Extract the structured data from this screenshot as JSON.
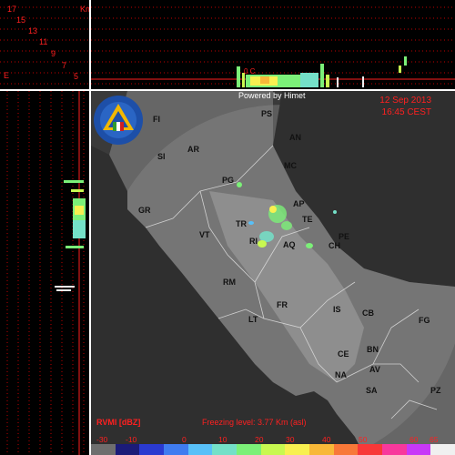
{
  "profile": {
    "km_label": "Km",
    "height_ticks": [
      "17",
      "15",
      "13",
      "11",
      "9",
      "7",
      "5"
    ],
    "corner_label": "E",
    "freezing_marker": "0 C"
  },
  "header": {
    "powered_by": "Powered by Himet",
    "date": "12 Sep 2013",
    "time": "16:45 CEST"
  },
  "map": {
    "cities": [
      {
        "code": "PS"
      },
      {
        "code": "FI"
      },
      {
        "code": "AN"
      },
      {
        "code": "AR"
      },
      {
        "code": "SI"
      },
      {
        "code": "MC"
      },
      {
        "code": "PG"
      },
      {
        "code": "GR"
      },
      {
        "code": "AP"
      },
      {
        "code": "TE"
      },
      {
        "code": "TR"
      },
      {
        "code": "PE"
      },
      {
        "code": "VT"
      },
      {
        "code": "RI"
      },
      {
        "code": "AQ"
      },
      {
        "code": "CH"
      },
      {
        "code": "RM"
      },
      {
        "code": "FR"
      },
      {
        "code": "IS"
      },
      {
        "code": "CB"
      },
      {
        "code": "FG"
      },
      {
        "code": "LT"
      },
      {
        "code": "CE"
      },
      {
        "code": "BN"
      },
      {
        "code": "AV"
      },
      {
        "code": "NA"
      },
      {
        "code": "SA"
      },
      {
        "code": "PZ"
      }
    ]
  },
  "legend": {
    "unit_label": "RVMI [dBZ]",
    "freezing_level": "Freezing level: 3.77 Km (asl)",
    "ticks": [
      "-30",
      "-10",
      "0",
      "10",
      "20",
      "30",
      "40",
      "50",
      "60",
      "65"
    ],
    "colors": [
      "#6e6e6e",
      "#1b1b78",
      "#2a3ad0",
      "#3f7cf0",
      "#58c0f8",
      "#74e0c8",
      "#7cf078",
      "#c8f850",
      "#f8f050",
      "#f8b838",
      "#f87838",
      "#f83838",
      "#f8389c",
      "#c838f8",
      "#f0f0f0"
    ]
  }
}
